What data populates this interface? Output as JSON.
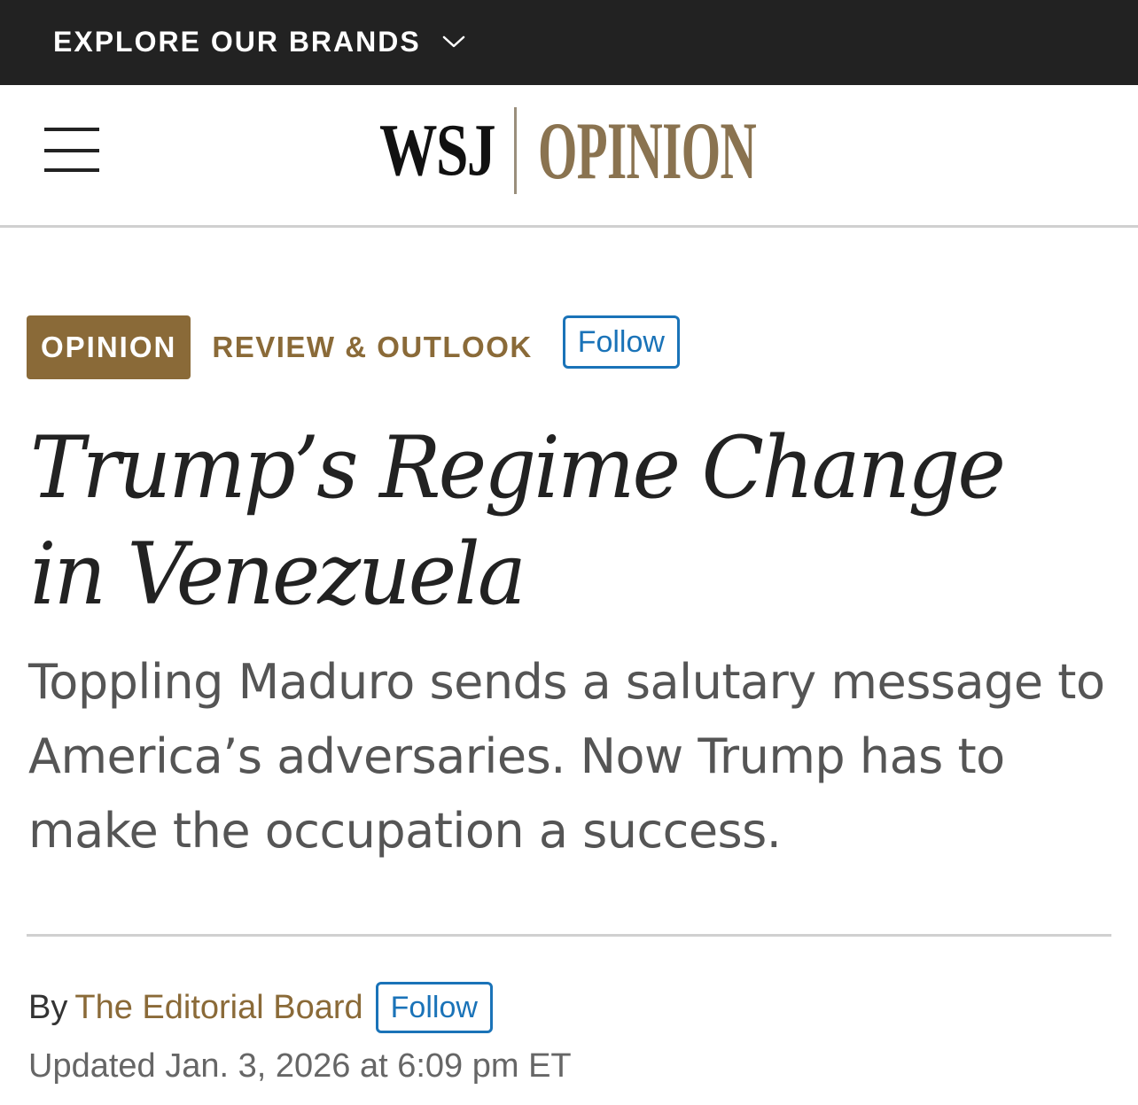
{
  "brand_bar": {
    "label": "EXPLORE OUR BRANDS",
    "icon": "chevron-down-icon"
  },
  "masthead": {
    "menu_icon": "hamburger-menu-icon",
    "logo_brand": "WSJ",
    "logo_section": "OPINION"
  },
  "section": {
    "badge": "OPINION",
    "column": "REVIEW & OUTLOOK",
    "follow_label": "Follow"
  },
  "article": {
    "headline": "Trump’s Regime Change in Venezuela",
    "dek": "Toppling Maduro sends a salutary message to America’s adversaries. Now Trump has to make the occupation a success.",
    "byline_prefix": "By",
    "author": "The Editorial Board",
    "author_follow_label": "Follow",
    "timestamp": "Updated Jan. 3, 2026 at 6:09 pm ET"
  },
  "colors": {
    "brand_bar_bg": "#222222",
    "opinion_gold": "#8a6a38",
    "follow_blue": "#1a73b8",
    "divider_gray": "#d0d0d0"
  }
}
